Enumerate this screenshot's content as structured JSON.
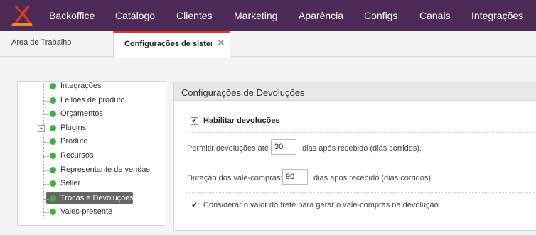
{
  "header": {
    "logo_icon": "x-logo-icon",
    "brand_color": "#4d2a57",
    "logo_color": "#e03a1f",
    "nav": [
      "Backoffice",
      "Catálogo",
      "Clientes",
      "Marketing",
      "Aparência",
      "Configs",
      "Canais",
      "Integrações"
    ]
  },
  "tabs": {
    "home_label": "Área de Trabalho",
    "active_label": "Configurações de sistema",
    "close_icon": "close-icon"
  },
  "sidebar": {
    "items": [
      {
        "label": "Integrações"
      },
      {
        "label": "Leilões de produto"
      },
      {
        "label": "Orçamentos"
      },
      {
        "label": "Plugins",
        "expandable": true
      },
      {
        "label": "Produto"
      },
      {
        "label": "Recursos"
      },
      {
        "label": "Representante de vendas"
      },
      {
        "label": "Seller"
      },
      {
        "label": "Trocas e Devoluções",
        "selected": true
      },
      {
        "label": "Vales-presente"
      }
    ],
    "status_color": "#3cb043"
  },
  "panel": {
    "title": "Configurações de Devoluções",
    "enable_label": "Habilitar devoluções",
    "enable_checked": true,
    "return_prefix": "Permitir devoluções até",
    "return_days": "30",
    "return_suffix": "dias após recebido (dias corridos).",
    "voucher_prefix": "Duração dos vale-compras:",
    "voucher_days": "90",
    "voucher_suffix": "dias após recebido (dias corridos).",
    "freight_label": "Considerar o valor do frete para gerar o vale-compras na devolução",
    "freight_checked": true
  }
}
